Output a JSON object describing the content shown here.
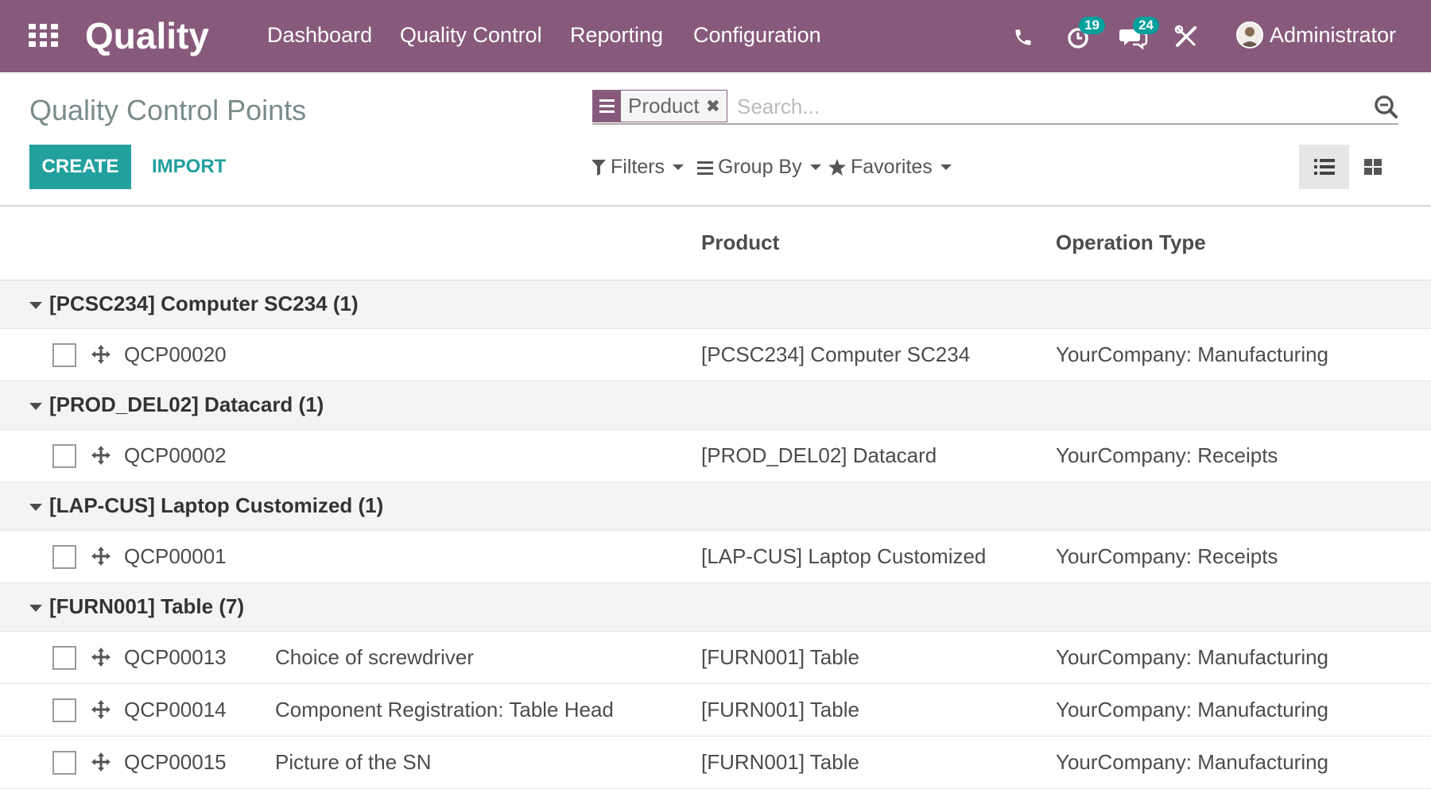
{
  "navbar": {
    "app_name": "Quality",
    "menus": [
      "Dashboard",
      "Quality Control",
      "Reporting",
      "Configuration"
    ],
    "activity_count": "19",
    "messages_count": "24",
    "user_name": "Administrator",
    "icons": [
      "apps-grid-icon",
      "phone-icon",
      "activity-clock-icon",
      "chat-icon",
      "debug-tools-icon"
    ]
  },
  "control_panel": {
    "title": "Quality Control Points",
    "create_label": "CREATE",
    "import_label": "IMPORT",
    "search": {
      "facet_label": "Product",
      "placeholder": "Search..."
    },
    "filters_label": "Filters",
    "groupby_label": "Group By",
    "favorites_label": "Favorites",
    "views": [
      "list-view-icon",
      "kanban-view-icon"
    ],
    "active_view": "list"
  },
  "list": {
    "columns": [
      "",
      "",
      "Product",
      "Operation Type"
    ],
    "groups": [
      {
        "title": "[PCSC234] Computer SC234 (1)",
        "rows": [
          {
            "reference": "QCP00020",
            "title": "",
            "product": "[PCSC234] Computer SC234",
            "operation": "YourCompany: Manufacturing"
          }
        ]
      },
      {
        "title": "[PROD_DEL02] Datacard (1)",
        "rows": [
          {
            "reference": "QCP00002",
            "title": "",
            "product": "[PROD_DEL02] Datacard",
            "operation": "YourCompany: Receipts"
          }
        ]
      },
      {
        "title": "[LAP-CUS] Laptop Customized (1)",
        "rows": [
          {
            "reference": "QCP00001",
            "title": "",
            "product": "[LAP-CUS] Laptop Customized",
            "operation": "YourCompany: Receipts"
          }
        ]
      },
      {
        "title": "[FURN001] Table (7)",
        "rows": [
          {
            "reference": "QCP00013",
            "title": "Choice of screwdriver",
            "product": "[FURN001] Table",
            "operation": "YourCompany: Manufacturing"
          },
          {
            "reference": "QCP00014",
            "title": "Component Registration: Table Head",
            "product": "[FURN001] Table",
            "operation": "YourCompany: Manufacturing"
          },
          {
            "reference": "QCP00015",
            "title": "Picture of the SN",
            "product": "[FURN001] Table",
            "operation": "YourCompany: Manufacturing"
          }
        ]
      }
    ]
  },
  "colors": {
    "navbar": "#875a7b",
    "primary_button": "#21a09e",
    "badge": "#00a09d"
  }
}
